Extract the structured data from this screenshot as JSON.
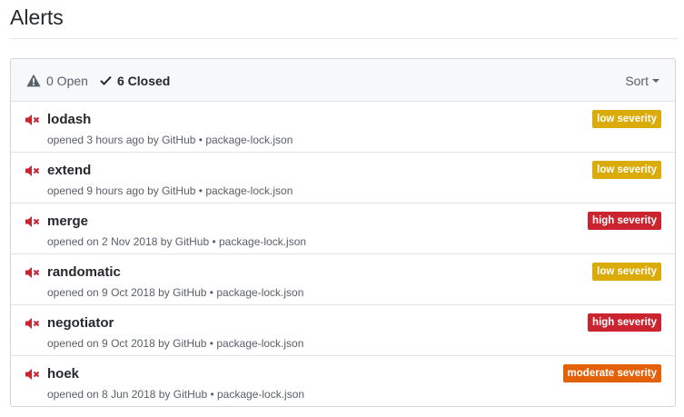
{
  "page": {
    "title": "Alerts"
  },
  "filters": {
    "open_label": "0 Open",
    "closed_label": "6 Closed",
    "sort_label": "Sort"
  },
  "colors": {
    "low": "#dbab09",
    "moderate": "#e36209",
    "high": "#cb2431",
    "mute_icon": "#cb2431"
  },
  "alerts": [
    {
      "name": "lodash",
      "meta": "opened 3 hours ago by GitHub • package-lock.json",
      "severity": "low",
      "severity_label": "low severity"
    },
    {
      "name": "extend",
      "meta": "opened 9 hours ago by GitHub • package-lock.json",
      "severity": "low",
      "severity_label": "low severity"
    },
    {
      "name": "merge",
      "meta": "opened on 2 Nov 2018 by GitHub • package-lock.json",
      "severity": "high",
      "severity_label": "high severity"
    },
    {
      "name": "randomatic",
      "meta": "opened on 9 Oct 2018 by GitHub • package-lock.json",
      "severity": "low",
      "severity_label": "low severity"
    },
    {
      "name": "negotiator",
      "meta": "opened on 9 Oct 2018 by GitHub • package-lock.json",
      "severity": "high",
      "severity_label": "high severity"
    },
    {
      "name": "hoek",
      "meta": "opened on 8 Jun 2018 by GitHub • package-lock.json",
      "severity": "moderate",
      "severity_label": "moderate severity"
    }
  ]
}
